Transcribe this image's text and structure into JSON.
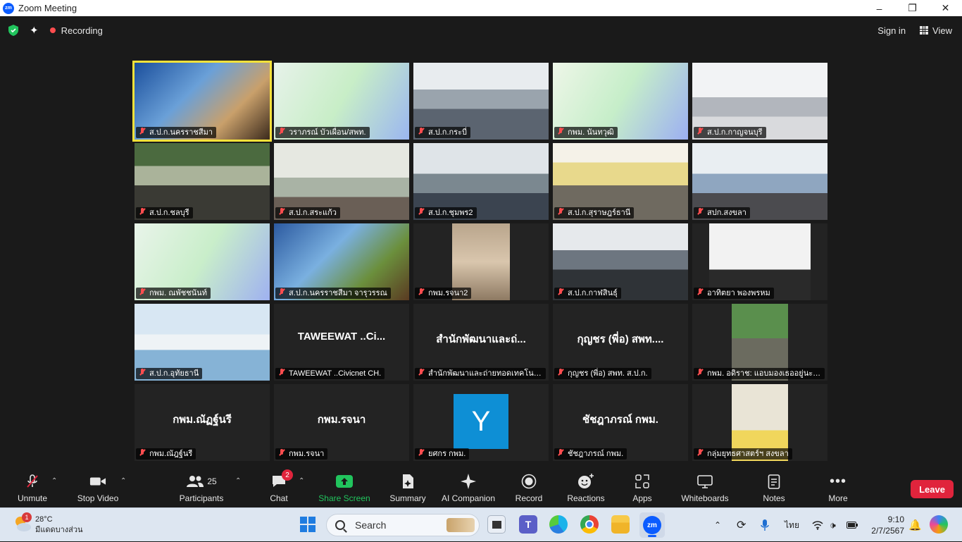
{
  "window": {
    "title": "Zoom Meeting",
    "logo_text": "zm"
  },
  "topbar": {
    "recording": "Recording",
    "sign_in": "Sign in",
    "view": "View"
  },
  "tiles": [
    {
      "name": "ส.ป.ก.นครราชสีมา"
    },
    {
      "name": "วราภรณ์ บัวเผื่อน/สพท."
    },
    {
      "name": "ส.ป.ก.กระบี่"
    },
    {
      "name": "กพม. นันทวุฒิ"
    },
    {
      "name": "ส.ป.ก.กาญจนบุรี"
    },
    {
      "name": "ส.ป.ก.ชลบุรี"
    },
    {
      "name": "ส.ป.ก.สระแก้ว"
    },
    {
      "name": "ส.ป.ก.ชุมพร2"
    },
    {
      "name": "ส.ป.ก.สุราษฎร์ธานี"
    },
    {
      "name": "สปก.สงขลา"
    },
    {
      "name": "กพม. ณพัชชนันท์"
    },
    {
      "name": "ส.ป.ก.นครราชสีมา จารุวรรณ"
    },
    {
      "name": "กพม.รจนา2"
    },
    {
      "name": "ส.ป.ก.กาฬสินธุ์"
    },
    {
      "name": "อาทิตยา พองพรหม"
    },
    {
      "name": "ส.ป.ก.อุทัยธานี"
    },
    {
      "name": "TAWEEWAT ..Civicnet CH.",
      "center": "TAWEEWAT ..Ci..."
    },
    {
      "name": "สำนักพัฒนาและถ่ายทอดเทคโนโ...",
      "center": "สำนักพัฒนาและถ่..."
    },
    {
      "name": "กุญชร (พี่อ) สพท. ส.ป.ก.",
      "center": "กุญชร (พี่อ) สพท...."
    },
    {
      "name": "กพม. อดิราช: แอบมองเธออยู่นะจ๊ะ"
    },
    {
      "name": "กพม.ณัฎฐ์นรี",
      "center": "กพม.ณัฏฐ์นรี"
    },
    {
      "name": "กพม.รจนา",
      "center": "กพม.รจนา"
    },
    {
      "name": "ยศกร กพม.",
      "avatar": "Y"
    },
    {
      "name": "ชัชฎาภรณ์ กพม.",
      "center": "ชัชฎาภรณ์ กพม."
    },
    {
      "name": "กลุ่มยุทธศาสตร์ฯ สงขลา"
    }
  ],
  "toolbar": {
    "unmute": "Unmute",
    "stop_video": "Stop Video",
    "participants": "Participants",
    "participants_count": "25",
    "chat": "Chat",
    "chat_badge": "2",
    "share_screen": "Share Screen",
    "summary": "Summary",
    "ai_companion": "AI Companion",
    "record": "Record",
    "reactions": "Reactions",
    "apps": "Apps",
    "whiteboards": "Whiteboards",
    "notes": "Notes",
    "more": "More",
    "leave": "Leave"
  },
  "taskbar": {
    "weather_temp": "28°C",
    "weather_desc": "มีแดดบางส่วน",
    "weather_badge": "1",
    "search": "Search",
    "lang": "ไทย",
    "time": "9:10",
    "date": "2/7/2567"
  },
  "colors": {
    "accent": "#0b5cff",
    "active_speaker": "#f5e23a",
    "leave": "#e0243c",
    "share": "#21c45d"
  }
}
